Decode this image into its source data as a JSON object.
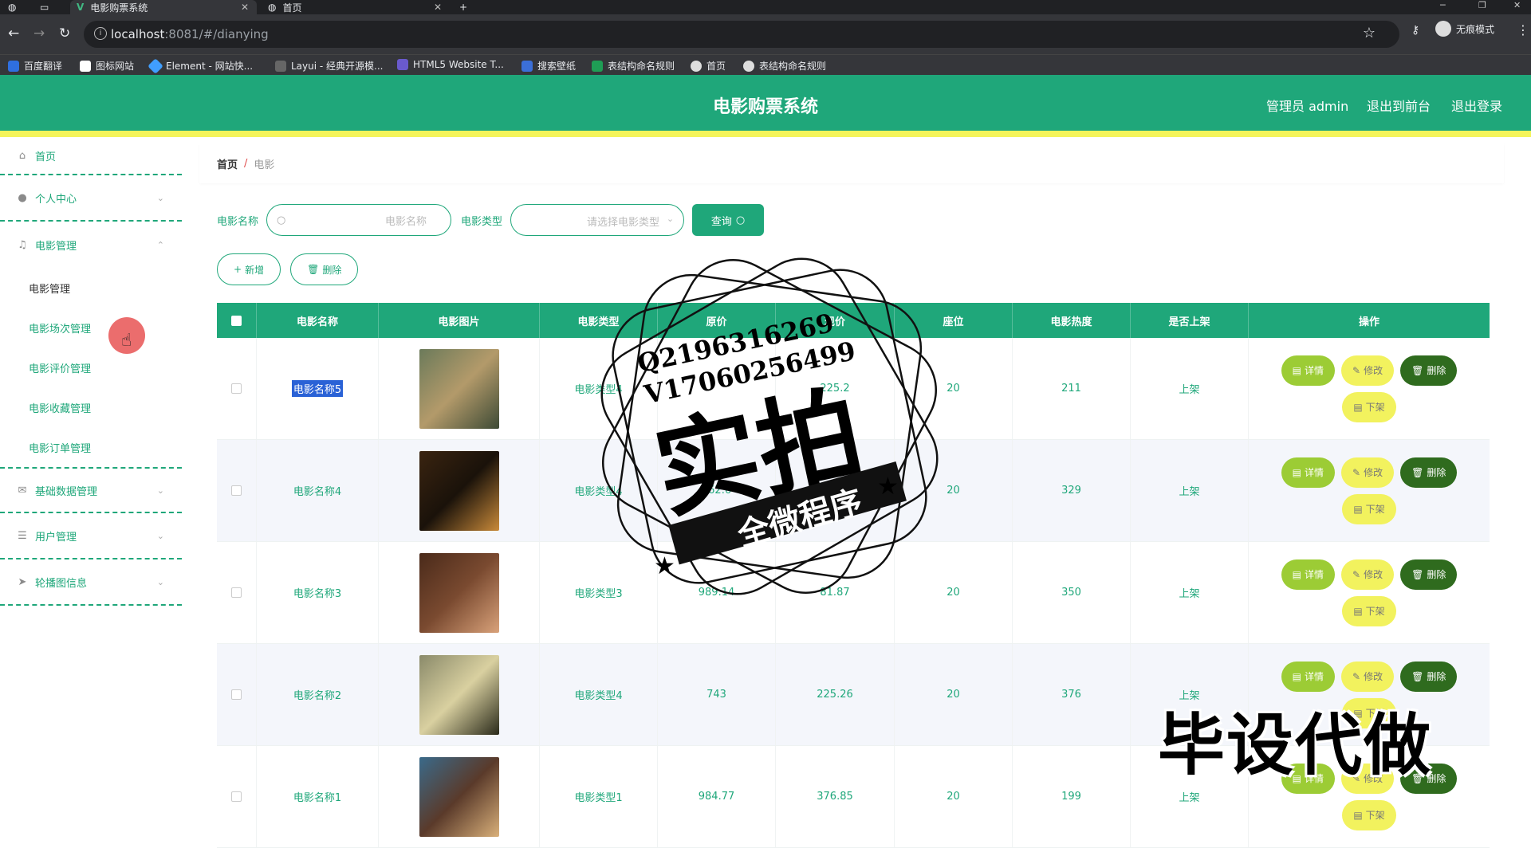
{
  "browser": {
    "tabs": [
      {
        "title": "电影购票系统"
      },
      {
        "title": "首页"
      }
    ],
    "url_host": "localhost",
    "url_rest": ":8081/#/dianying",
    "profile_label": "无痕模式",
    "bookmarks": [
      {
        "label": "百度翻译",
        "color": "#2f6fe0"
      },
      {
        "label": "图标网站",
        "color": "#ffffff"
      },
      {
        "label": "Element - 网站快...",
        "color": "#409eff"
      },
      {
        "label": "Layui - 经典开源模...",
        "color": "#666666"
      },
      {
        "label": "HTML5 Website T...",
        "color": "#6a5acd"
      },
      {
        "label": "搜索壁纸",
        "color": "#3b6fd8"
      },
      {
        "label": "表结构命名规则",
        "color": "#1f9d55"
      },
      {
        "label": "首页",
        "color": "#dddddd"
      },
      {
        "label": "表结构命名规则",
        "color": "#dddddd"
      }
    ]
  },
  "header": {
    "title": "电影购票系统",
    "admin": "管理员 admin",
    "to_front": "退出到前台",
    "logout": "退出登录"
  },
  "sidebar": {
    "home": "首页",
    "personal": "个人中心",
    "movie_mgmt": "电影管理",
    "sub_items": [
      "电影管理",
      "电影场次管理",
      "电影评价管理",
      "电影收藏管理",
      "电影订单管理"
    ],
    "base_data": "基础数据管理",
    "users": "用户管理",
    "carousel": "轮播图信息"
  },
  "breadcrumb": {
    "home": "首页",
    "sep": "/",
    "current": "电影"
  },
  "search": {
    "name_label": "电影名称",
    "name_placeholder": "电影名称",
    "type_label": "电影类型",
    "type_placeholder": "请选择电影类型",
    "query_label": "查询"
  },
  "actions": {
    "add": "新增",
    "delete": "删除"
  },
  "table": {
    "headers": [
      "电影名称",
      "电影图片",
      "电影类型",
      "原价",
      "现价",
      "座位",
      "电影热度",
      "是否上架",
      "操作"
    ],
    "rows": [
      {
        "name": "电影名称5",
        "type": "电影类型4",
        "orig": "",
        "price": "225.2",
        "seats": "20",
        "heat": "211",
        "status": "上架",
        "poster": [
          "#6b7a5a",
          "#3d4a35",
          "#b39a6a"
        ]
      },
      {
        "name": "电影名称4",
        "type": "电影类型4",
        "orig": "962.6",
        "price": "",
        "seats": "20",
        "heat": "329",
        "status": "上架",
        "poster": [
          "#3a2410",
          "#c98a3a",
          "#1a120a"
        ]
      },
      {
        "name": "电影名称3",
        "type": "电影类型3",
        "orig": "989.14",
        "price": "81.87",
        "seats": "20",
        "heat": "350",
        "status": "上架",
        "poster": [
          "#4a2a1a",
          "#d9a27a",
          "#7a4a30"
        ]
      },
      {
        "name": "电影名称2",
        "type": "电影类型4",
        "orig": "743",
        "price": "225.26",
        "seats": "20",
        "heat": "376",
        "status": "上架",
        "poster": [
          "#8a8a6a",
          "#2a2a1a",
          "#d9d0a0"
        ]
      },
      {
        "name": "电影名称1",
        "type": "电影类型1",
        "orig": "984.77",
        "price": "376.85",
        "seats": "20",
        "heat": "199",
        "status": "上架",
        "poster": [
          "#3a6a8a",
          "#d9b07a",
          "#5a3a2a"
        ]
      }
    ],
    "op_detail": "详情",
    "op_edit": "修改",
    "op_delete": "删除",
    "op_off": "下架"
  },
  "watermark": {
    "qq": "Q2196316269",
    "vx": "V17060256499",
    "big": "实拍",
    "ribbon": "全微程序",
    "corner": "毕设代做"
  }
}
